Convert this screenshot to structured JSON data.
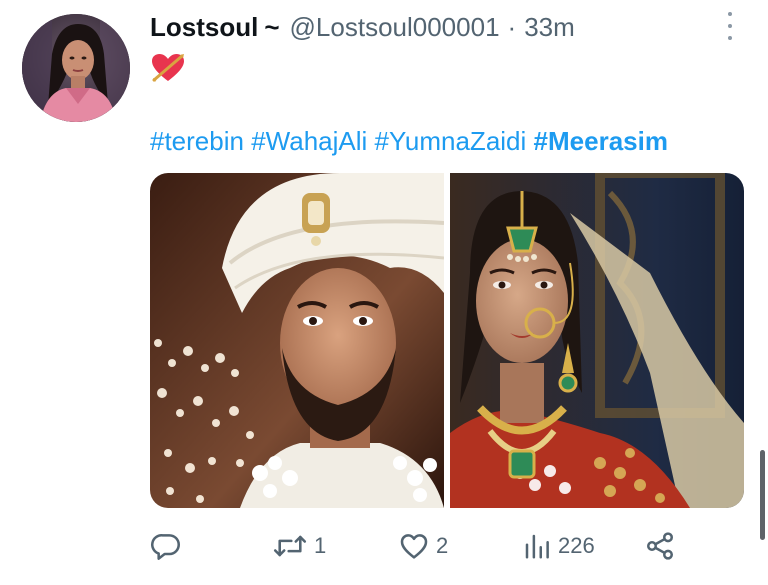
{
  "tweet": {
    "display_name": "Lostsoul",
    "name_suffix": "~",
    "handle": "@Lostsoul000001",
    "separator": "·",
    "time": "33m",
    "body_emoji": "heart-with-arrow",
    "hashtags": [
      "#terebin",
      "#WahajAli",
      "#YumnaZaidi",
      "#Meerasim"
    ],
    "link_color": "#1d9bf0",
    "muted_color": "#536471"
  },
  "media": {
    "photos": [
      {
        "subject": "groom"
      },
      {
        "subject": "bride"
      }
    ]
  },
  "actions": {
    "reply": {
      "icon": "reply-icon",
      "count": ""
    },
    "retweet": {
      "icon": "retweet-icon",
      "count": "1"
    },
    "like": {
      "icon": "heart-icon",
      "count": "2"
    },
    "views": {
      "icon": "views-icon",
      "count": "226"
    },
    "share": {
      "icon": "share-icon"
    }
  },
  "more": {
    "icon": "more-vertical-icon"
  }
}
